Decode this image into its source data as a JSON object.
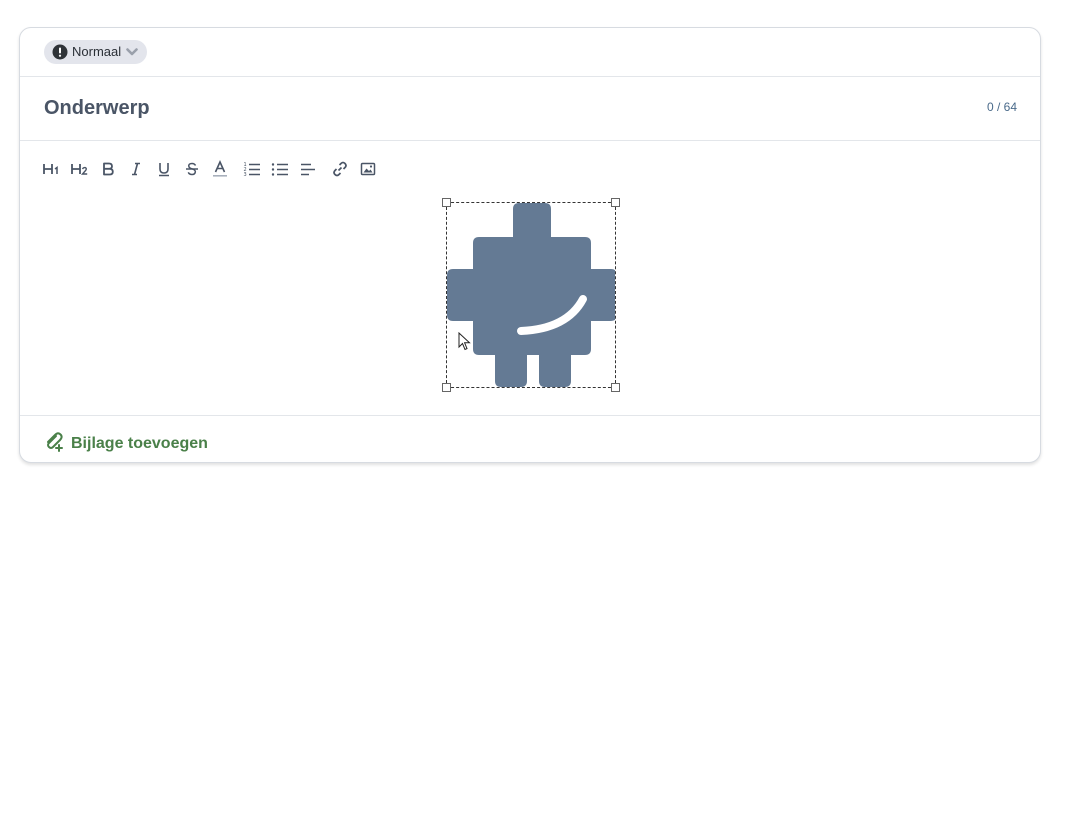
{
  "priority": {
    "label": "Normaal",
    "icon": "alert-circle-icon",
    "chevron": "chevron-down-icon"
  },
  "subject": {
    "placeholder": "Onderwerp",
    "value": "",
    "char_count": "0 / 64"
  },
  "toolbar": {
    "buttons": [
      {
        "name": "heading-1",
        "icon": "h1-icon"
      },
      {
        "name": "heading-2",
        "icon": "h2-icon"
      },
      {
        "name": "bold",
        "icon": "bold-icon"
      },
      {
        "name": "italic",
        "icon": "italic-icon"
      },
      {
        "name": "underline",
        "icon": "underline-icon"
      },
      {
        "name": "strikethrough",
        "icon": "strikethrough-icon"
      },
      {
        "name": "text-color",
        "icon": "text-color-icon"
      },
      {
        "name": "ordered-list",
        "icon": "ordered-list-icon"
      },
      {
        "name": "bullet-list",
        "icon": "bullet-list-icon"
      },
      {
        "name": "align",
        "icon": "align-left-icon"
      },
      {
        "name": "link",
        "icon": "link-icon"
      },
      {
        "name": "image",
        "icon": "image-icon"
      }
    ]
  },
  "editor": {
    "image": {
      "description_icon": "puzzle-logo-image",
      "fill_color": "#647a94",
      "selected": true
    }
  },
  "attachment": {
    "label": "Bijlage toevoegen",
    "icon": "paperclip-add-icon",
    "color": "#4a8049"
  }
}
